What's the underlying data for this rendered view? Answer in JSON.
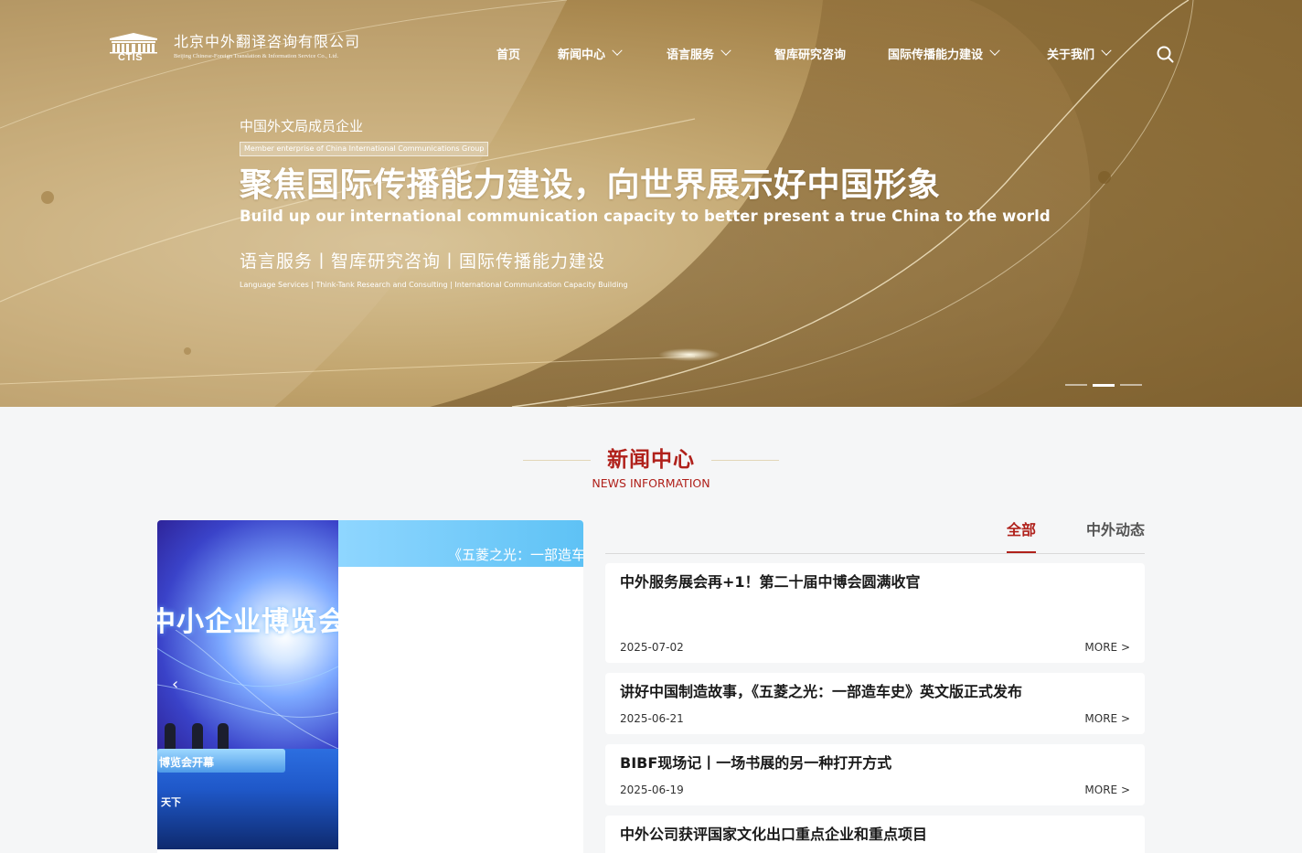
{
  "header": {
    "company_cn": "北京中外翻译咨询有限公司",
    "company_en": "Beijing Chinese-Foreign Translation & Information Service Co., Ltd.",
    "logo_abbr": "CTIS",
    "nav": [
      {
        "label": "首页",
        "has_dropdown": false
      },
      {
        "label": "新闻中心",
        "has_dropdown": true
      },
      {
        "label": "语言服务",
        "has_dropdown": true
      },
      {
        "label": "智库研究咨询",
        "has_dropdown": false
      },
      {
        "label": "国际传播能力建设",
        "has_dropdown": true
      },
      {
        "label": "关于我们",
        "has_dropdown": true
      }
    ],
    "search_icon": "search-icon"
  },
  "hero": {
    "sub_cn": "中国外文局成员企业",
    "badge_en": "Member enterprise of China International Communications Group",
    "headline_cn": "聚焦国际传播能力建设，向世界展示好中国形象",
    "headline_en": "Build up our international communication capacity to better present a true China to the world",
    "services_cn": "语言服务丨智库研究咨询丨国际传播能力建设",
    "services_en": "Language Services | Think-Tank Research and Consulting | International Communication Capacity Building",
    "slides_count": 3,
    "active_slide": 2
  },
  "news": {
    "title_cn": "新闻中心",
    "title_en": "NEWS INFORMATION",
    "feature": {
      "photo_text": "中小企业博览会",
      "stage_text": "博览会开幕",
      "corner_text": "天下",
      "banner_text": "《五菱之光：一部造车史",
      "prev_icon": "chevron-left-icon"
    },
    "tabs": [
      {
        "label": "全部",
        "active": true
      },
      {
        "label": "中外动态",
        "active": false
      }
    ],
    "items": [
      {
        "title": "中外服务展会再+1！第二十届中博会圆满收官",
        "date": "2025-07-02",
        "more": "MORE >"
      },
      {
        "title": "讲好中国制造故事，《五菱之光：一部造车史》英文版正式发布",
        "date": "2025-06-21",
        "more": "MORE >"
      },
      {
        "title": "BIBF现场记丨一场书展的另一种打开方式",
        "date": "2025-06-19",
        "more": "MORE >"
      },
      {
        "title": "中外公司获评国家文化出口重点企业和重点项目",
        "date": "",
        "more": ""
      }
    ]
  },
  "colors": {
    "accent": "#b0211b",
    "hero_gold": "#c4a872",
    "background": "#f5f6f7"
  }
}
